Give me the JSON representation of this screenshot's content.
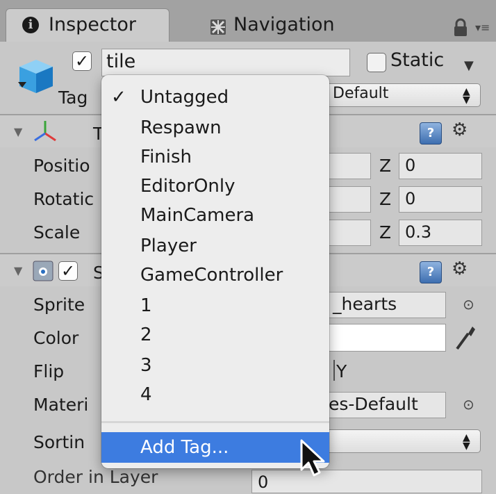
{
  "tabs": {
    "inspector": "Inspector",
    "navigation": "Navigation"
  },
  "header": {
    "name_value": "tile",
    "static_label": "Static",
    "tag_label": "Tag",
    "layer_value": "Default"
  },
  "transform": {
    "header_fragment": "T",
    "position_label": "Positio",
    "rotation_label": "Rotatic",
    "scale_label": "Scale",
    "z_label": "Z",
    "position_z": "0",
    "rotation_z": "0",
    "scale_z": "0.3"
  },
  "sprite_renderer": {
    "header_fragment": "S",
    "sprite_label": "Sprite",
    "sprite_value": "_hearts",
    "color_label": "Color",
    "flip_label": "Flip",
    "flip_y_label": "Y",
    "material_label": "Materi",
    "material_value": "es-Default",
    "sorting_label": "Sortin",
    "order_label_partial": "Order in Layer",
    "order_value": "0"
  },
  "tag_menu": {
    "items": [
      "Untagged",
      "Respawn",
      "Finish",
      "EditorOnly",
      "MainCamera",
      "Player",
      "GameController",
      "1",
      "2",
      "3",
      "4"
    ],
    "selected": "Untagged",
    "add_tag": "Add Tag...",
    "check_glyph": "✓"
  },
  "colors": {
    "highlight": "#3d7ce0",
    "panel": "#c8c8c8"
  }
}
